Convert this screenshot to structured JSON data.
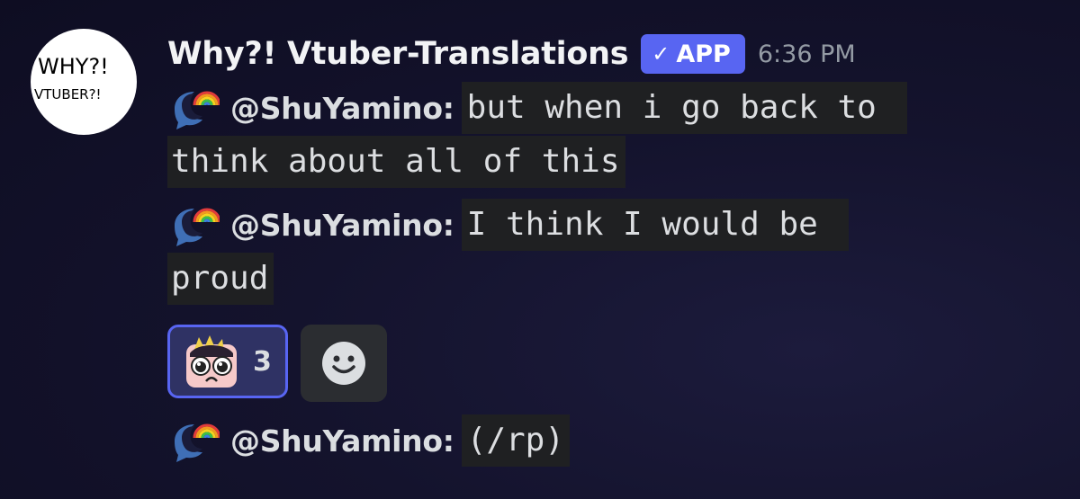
{
  "avatar": {
    "line1": "WHY?!",
    "line2": "VTUBER?!"
  },
  "header": {
    "username": "Why?! Vtuber-Translations",
    "badge": "APP",
    "timestamp": "6:36 PM"
  },
  "messages": [
    {
      "mention": "@ShuYamino:",
      "text_line1": "but when i go back to",
      "text_line2": "think about all of this"
    },
    {
      "mention": "@ShuYamino:",
      "text_line1": "I think I would be",
      "text_line2": "proud"
    },
    {
      "mention": "@ShuYamino:",
      "text_line1": "(/rp)"
    }
  ],
  "reaction": {
    "emoji": "pleading-face-emoji",
    "count": "3"
  },
  "icons": {
    "moon_rainbow": "moon-rainbow-icon",
    "add_reaction": "smiley-icon"
  },
  "colors": {
    "accent": "#5865f2",
    "background": "#14132d",
    "code_bg": "#1f2022"
  }
}
